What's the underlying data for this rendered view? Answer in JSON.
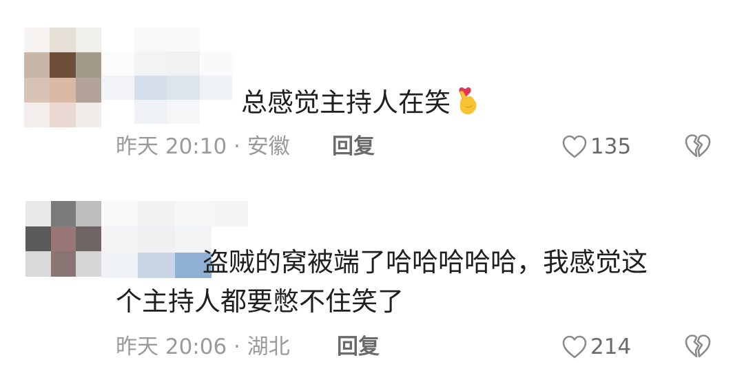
{
  "comments": [
    {
      "text": "总感觉主持人在笑",
      "emoji_icon": "heart-finger-emoji",
      "time": "昨天 20:10",
      "location": "安徽",
      "reply_label": "回复",
      "likes": "135"
    },
    {
      "text_line1": "盗贼的窝被端了哈哈哈哈哈，我感觉这",
      "text_line2": "个主持人都要憋不住笑了",
      "time": "昨天 20:06",
      "location": "湖北",
      "reply_label": "回复",
      "likes": "214"
    }
  ],
  "icons": {
    "like": "heart-outline-icon",
    "dislike": "broken-heart-icon"
  },
  "colors": {
    "text": "#1f1f1f",
    "meta": "#9a9a9a",
    "action": "#6a6a6a"
  }
}
